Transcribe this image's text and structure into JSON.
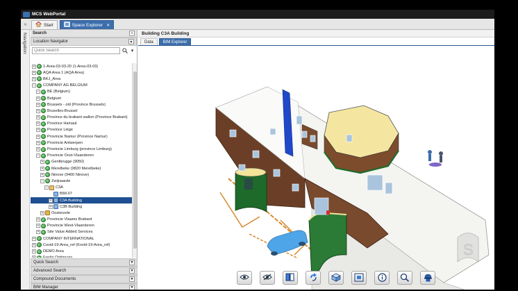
{
  "app": {
    "title": "MCS WebPortal"
  },
  "tabs": [
    {
      "label": "Start",
      "icon": "home-icon",
      "active": false
    },
    {
      "label": "Space Explorer",
      "icon": "space-explorer-icon",
      "active": true,
      "closable": true
    }
  ],
  "nav_rail": {
    "label": "Navigation"
  },
  "search_panel": {
    "title": "Search",
    "collapse_label": "«"
  },
  "location_navigator": {
    "title": "Location Navigator",
    "search_placeholder": "Quick Search",
    "tree": [
      {
        "label": "1-Area-03-03-20 (1-Area-03-03)",
        "level": 0,
        "expander": "+",
        "icon": "site"
      },
      {
        "label": "AQA Area 1 (AQA Area)",
        "level": 0,
        "expander": "+",
        "icon": "site"
      },
      {
        "label": "BKJ_Area",
        "level": 0,
        "expander": "+",
        "icon": "site"
      },
      {
        "label": "COMPANY AG BELGIUM",
        "level": 0,
        "expander": "-",
        "icon": "site"
      },
      {
        "label": "BE (Belgium)",
        "level": 1,
        "expander": "-",
        "icon": "site"
      },
      {
        "label": "Belgium",
        "level": 1,
        "expander": "+",
        "icon": "site"
      },
      {
        "label": "Brussels - old (Province Brussels)",
        "level": 1,
        "expander": "+",
        "icon": "site"
      },
      {
        "label": "Bruxelles-Brussel",
        "level": 1,
        "expander": "+",
        "icon": "site"
      },
      {
        "label": "Province du brabant wallon (Province Brabant)",
        "level": 1,
        "expander": "+",
        "icon": "site"
      },
      {
        "label": "Province Hainaut",
        "level": 1,
        "expander": "+",
        "icon": "site"
      },
      {
        "label": "Province Liège",
        "level": 1,
        "expander": "+",
        "icon": "site"
      },
      {
        "label": "Provincie Namur (Province Namur)",
        "level": 1,
        "expander": "+",
        "icon": "site"
      },
      {
        "label": "Provincie Antwerpen",
        "level": 1,
        "expander": "+",
        "icon": "site"
      },
      {
        "label": "Provincie Limburg (province Limburg)",
        "level": 1,
        "expander": "+",
        "icon": "site"
      },
      {
        "label": "Provincie Oost-Vlaanderen",
        "level": 1,
        "expander": "-",
        "icon": "site"
      },
      {
        "label": "Gentbrugge (9050)",
        "level": 2,
        "expander": "+",
        "icon": "site"
      },
      {
        "label": "Merelbeke (9820 Merelbeke)",
        "level": 2,
        "expander": "+",
        "icon": "site"
      },
      {
        "label": "Ninove (9400 Ninove)",
        "level": 2,
        "expander": "+",
        "icon": "site"
      },
      {
        "label": "Zwijnaarde",
        "level": 2,
        "expander": "-",
        "icon": "site"
      },
      {
        "label": "C3A",
        "level": 3,
        "expander": "-",
        "icon": "building"
      },
      {
        "label": "BIM-07",
        "level": 4,
        "expander": "",
        "icon": "floor"
      },
      {
        "label": "C3A Building",
        "level": 4,
        "expander": "+",
        "icon": "floor",
        "selected": true
      },
      {
        "label": "C3B Building",
        "level": 4,
        "expander": "+",
        "icon": "floor"
      },
      {
        "label": "Oosterzele",
        "level": 2,
        "expander": "+",
        "icon": "folder"
      },
      {
        "label": "Provincie Vlaams Brabant",
        "level": 1,
        "expander": "+",
        "icon": "site"
      },
      {
        "label": "Provincie West-Vlaanderen",
        "level": 1,
        "expander": "+",
        "icon": "site"
      },
      {
        "label": "Site Value Added Services",
        "level": 1,
        "expander": "+",
        "icon": "site"
      },
      {
        "label": "COMPANY INTERNATIONAL",
        "level": 0,
        "expander": "+",
        "icon": "site"
      },
      {
        "label": "Covid-19-Area_ref (Kovid-19-Area_ref)",
        "level": 0,
        "expander": "+",
        "icon": "site"
      },
      {
        "label": "DEMO Area",
        "level": 0,
        "expander": "+",
        "icon": "site"
      },
      {
        "label": "Fredis Optimusia",
        "level": 0,
        "expander": "+",
        "icon": "site"
      }
    ]
  },
  "accordions": [
    {
      "label": "Quick Search"
    },
    {
      "label": "Advanced Search"
    },
    {
      "label": "Compound Documents"
    },
    {
      "label": "BIM Manager"
    }
  ],
  "content": {
    "title": "Building C3A Building",
    "subtabs": [
      {
        "label": "Data",
        "active": false
      },
      {
        "label": "BIM Explorer",
        "active": true
      }
    ]
  },
  "viewer_toolbar": [
    {
      "icon": "eye-show-icon"
    },
    {
      "icon": "eye-hide-icon"
    },
    {
      "icon": "split-view-icon"
    },
    {
      "icon": "rotate-icon"
    },
    {
      "icon": "cube-view-icon"
    },
    {
      "icon": "fit-view-icon"
    },
    {
      "icon": "info-icon"
    },
    {
      "icon": "zoom-icon"
    },
    {
      "icon": "worker-icon"
    }
  ],
  "colors": {
    "accent_tab": "#3d6eac",
    "selected_row": "#1d4f92",
    "title_bar": "#1c1c1c"
  }
}
